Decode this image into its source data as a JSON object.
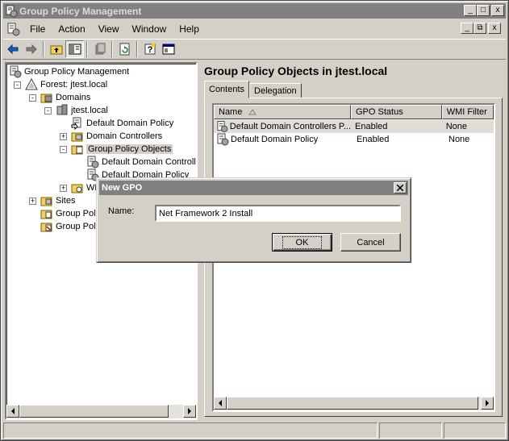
{
  "window": {
    "title": "Group Policy Management",
    "caption_buttons": [
      "_",
      "□",
      "x"
    ]
  },
  "menubar": {
    "items": [
      {
        "label": "File"
      },
      {
        "label": "Action"
      },
      {
        "label": "View"
      },
      {
        "label": "Window"
      },
      {
        "label": "Help"
      }
    ],
    "mdi_buttons": [
      "_",
      "⧉",
      "x"
    ]
  },
  "toolbar": {
    "buttons": [
      "back-arrow",
      "forward-arrow",
      "up-folder",
      "show-hide-tree",
      "delete",
      "refresh",
      "help",
      "properties"
    ]
  },
  "tree": {
    "nodes": [
      {
        "label": "Group Policy Management",
        "icon": "gpm-icon"
      },
      {
        "label": "Forest: jtest.local",
        "icon": "forest-icon",
        "expander": "-"
      },
      {
        "label": "Domains",
        "icon": "domains-folder-icon",
        "expander": "-"
      },
      {
        "label": "jtest.local",
        "icon": "domain-icon",
        "expander": "-"
      },
      {
        "label": "Default Domain Policy",
        "icon": "gpo-link-icon"
      },
      {
        "label": "Domain Controllers",
        "icon": "ou-icon",
        "expander": "+"
      },
      {
        "label": "Group Policy Objects",
        "icon": "gpo-folder-icon",
        "expander": "-"
      },
      {
        "label": "Default Domain Controlle",
        "icon": "gpo-icon"
      },
      {
        "label": "Default Domain Policy",
        "icon": "gpo-icon"
      },
      {
        "label": "WM",
        "icon": "wmi-folder-icon",
        "expander": "+"
      },
      {
        "label": "Sites",
        "icon": "sites-folder-icon",
        "expander": "+"
      },
      {
        "label": "Group Polic",
        "icon": "gp-modeling-icon"
      },
      {
        "label": "Group Polic",
        "icon": "gp-results-icon"
      }
    ]
  },
  "right_pane": {
    "title": "Group Policy Objects in jtest.local",
    "tabs": [
      {
        "label": "Contents"
      },
      {
        "label": "Delegation"
      }
    ],
    "columns": [
      "Name",
      "GPO Status",
      "WMI Filter"
    ],
    "rows": [
      {
        "name": "Default Domain Controllers P...",
        "status": "Enabled",
        "wmi": "None"
      },
      {
        "name": "Default Domain Policy",
        "status": "Enabled",
        "wmi": "None"
      }
    ]
  },
  "dialog": {
    "title": "New GPO",
    "name_label": "Name:",
    "name_value": "Net Framework 2 Install",
    "ok_label": "OK",
    "cancel_label": "Cancel"
  },
  "colors": {
    "face": "#d4d0c8",
    "inactive_title": "#808080",
    "highlight": "#fff"
  }
}
